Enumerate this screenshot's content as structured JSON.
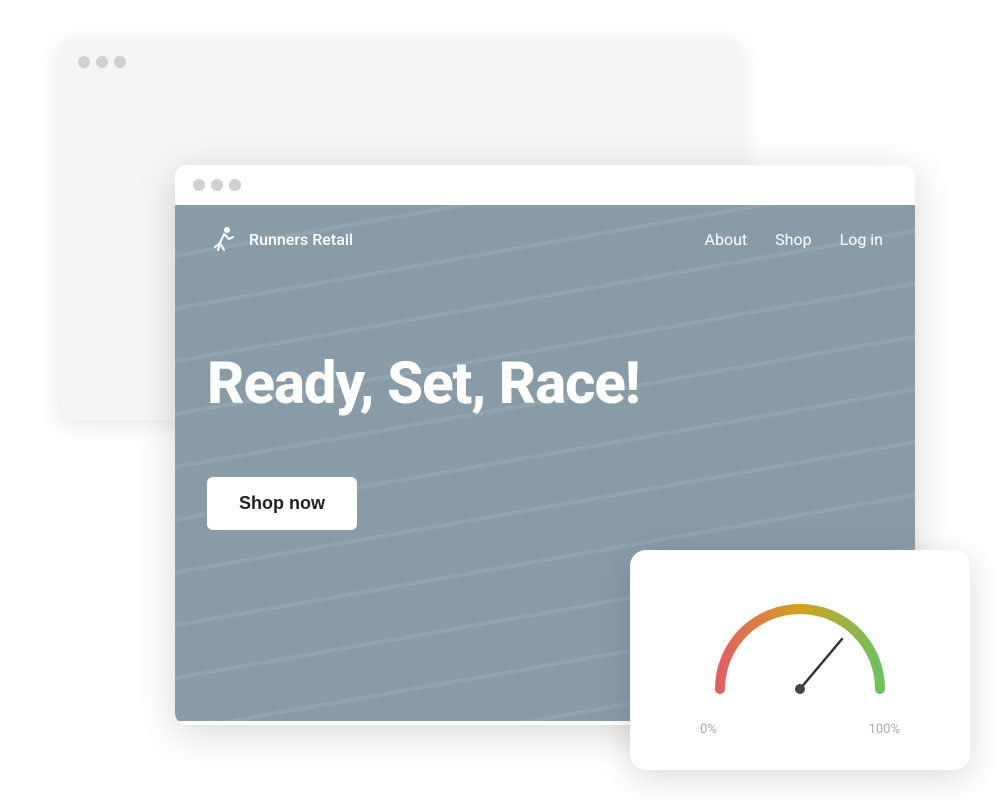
{
  "back_browser": {
    "traffic_lights": [
      "dot1",
      "dot2",
      "dot3"
    ]
  },
  "front_browser": {
    "traffic_lights": [
      "dot1",
      "dot2",
      "dot3"
    ],
    "nav": {
      "brand_name": "Runners Retail",
      "links": [
        "About",
        "Shop",
        "Log in"
      ]
    },
    "hero": {
      "title": "Ready, Set, Race!",
      "cta_label": "Shop now"
    }
  },
  "gauge": {
    "label_left": "0%",
    "label_right": "100%",
    "needle_angle": 45,
    "arc_start_color": "#e06060",
    "arc_end_color": "#80c060"
  }
}
